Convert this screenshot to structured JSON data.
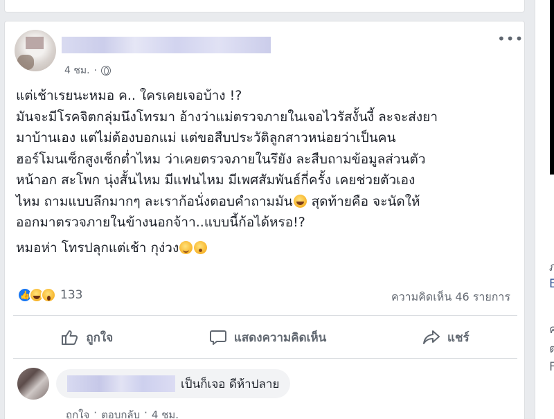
{
  "post": {
    "timestamp": "4 ชม.",
    "privacy_icon": "globe-icon",
    "text_lines": [
      "แต่เช้าเรยนะหมอ ค.. ใครเคยเจอบ้าง !?",
      "มันจะมีโรคจิตกลุ่มนึงโทรมา อ้างว่าแม่ตรวจภายในเจอไวรัสงั้นงี้ ละจะส่งยา",
      "มาบ้านเอง แต่ไม่ต้องบอกแม่ แต่ขอสืบประวัติลูกสาวหน่อยว่าเป็นคน",
      "ฮอร์โมนเซ็กสูงเซ็กต่ำไหม ว่าเคยตรวจภายในรึยัง ละสืบถามข้อมูลส่วนตัว",
      "หน้าอก สะโพก นุ่งสั้นไหม มีแฟนไหม มีเพศสัมพันธ์กี่ครั้ง เคยช่วยตัวเอง",
      "ไหม ถามแบบลึกมากๆ ละเราก้อนั่งตอบคำถามมัน",
      " สุดท้ายคือ จะนัดให้",
      "ออกมาตรวจภายในข้างนอกจ้าา..แบบนี้ก้อได้หรอ!?"
    ],
    "last_line": "หมอห่า โทรปลุกแต่เช้า กุง่วง",
    "reaction_count": "133",
    "comment_count": "ความคิดเห็น 46 รายการ"
  },
  "actions": {
    "like": "ถูกใจ",
    "comment": "แสดงความคิดเห็น",
    "share": "แชร์"
  },
  "comment": {
    "text": "เป็นก็เจอ ดีห้าปลาย",
    "like": "ถูกใจ",
    "reply": "ตอบกลับ",
    "time": "4 ชม."
  },
  "sidebar": {
    "letters": [
      "ภ",
      "E",
      "ค",
      "ต",
      "F"
    ]
  },
  "colors": {
    "like_blue": "#1877f2",
    "link_blue": "#385898",
    "meta_gray": "#616770"
  }
}
